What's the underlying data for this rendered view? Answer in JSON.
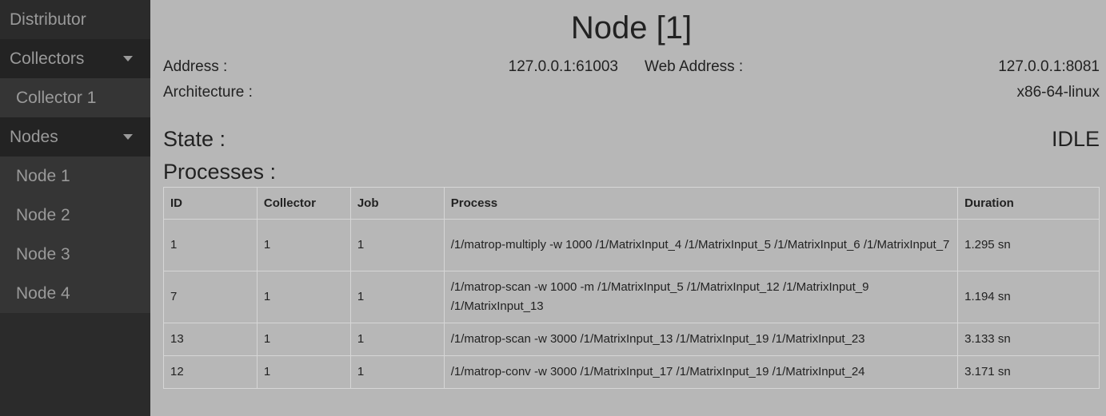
{
  "sidebar": {
    "distributor": "Distributor",
    "collectors": {
      "label": "Collectors",
      "items": [
        "Collector 1"
      ]
    },
    "nodes": {
      "label": "Nodes",
      "items": [
        "Node 1",
        "Node 2",
        "Node 3",
        "Node 4"
      ]
    }
  },
  "main": {
    "title": "Node [1]",
    "address_label": "Address :",
    "address_value": "127.0.0.1:61003",
    "web_address_label": "Web Address :",
    "web_address_value": "127.0.0.1:8081",
    "architecture_label": "Architecture :",
    "architecture_value": "x86-64-linux",
    "state_label": "State :",
    "state_value": "IDLE",
    "processes_label": "Processes :"
  },
  "table": {
    "headers": [
      "ID",
      "Collector",
      "Job",
      "Process",
      "Duration"
    ],
    "rows": [
      [
        "1",
        "1",
        "1",
        "/1/matrop-multiply -w 1000 /1/MatrixInput_4 /1/MatrixInput_5 /1/MatrixInput_6 /1/MatrixInput_7",
        "1.295 sn"
      ],
      [
        "7",
        "1",
        "1",
        "/1/matrop-scan -w 1000 -m /1/MatrixInput_5 /1/MatrixInput_12 /1/MatrixInput_9 /1/MatrixInput_13",
        "1.194 sn"
      ],
      [
        "13",
        "1",
        "1",
        "/1/matrop-scan -w 3000 /1/MatrixInput_13 /1/MatrixInput_19 /1/MatrixInput_23",
        "3.133 sn"
      ],
      [
        "12",
        "1",
        "1",
        "/1/matrop-conv -w 3000 /1/MatrixInput_17 /1/MatrixInput_19 /1/MatrixInput_24",
        "3.171 sn"
      ]
    ]
  }
}
